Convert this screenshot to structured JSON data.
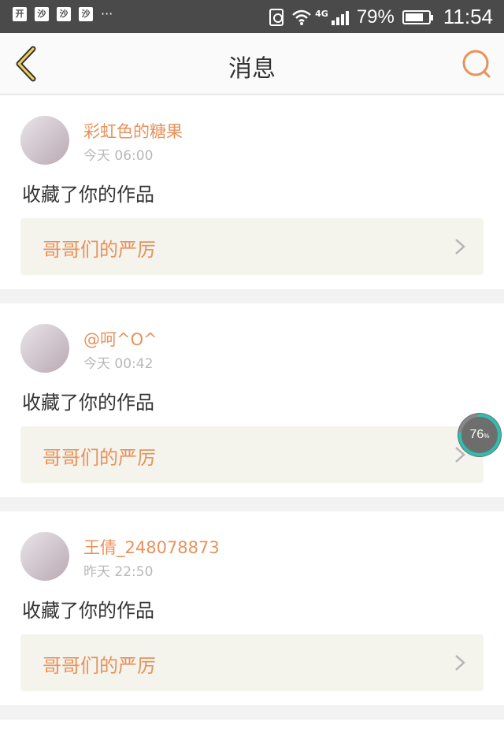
{
  "status_bar": {
    "left_badges": [
      "开",
      "沙",
      "沙",
      "沙"
    ],
    "more": "···",
    "network": "4G",
    "battery_percent_text": "79%",
    "battery_level": 0.79,
    "time": "11:54"
  },
  "header": {
    "title": "消息",
    "back_icon": "chevron-left-icon",
    "search_icon": "search-icon",
    "accent_color": "#e8925b"
  },
  "messages": [
    {
      "user_name": "彩虹色的糖果",
      "timestamp": "今天 06:00",
      "action": "收藏了你的作品",
      "work_title": "哥哥们的严厉"
    },
    {
      "user_name": "@呵^O^",
      "timestamp": "今天 00:42",
      "action": "收藏了你的作品",
      "work_title": "哥哥们的严厉"
    },
    {
      "user_name": "王倩_248078873",
      "timestamp": "昨天 22:50",
      "action": "收藏了你的作品",
      "work_title": "哥哥们的严厉"
    }
  ],
  "floating_badge": {
    "value": "76",
    "unit": "%",
    "progress": 0.76,
    "ring_color": "#2bbfb0"
  }
}
